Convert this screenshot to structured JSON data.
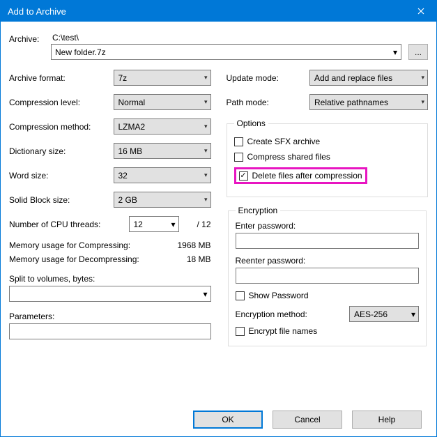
{
  "title": "Add to Archive",
  "archive": {
    "label": "Archive:",
    "path": "C:\\test\\",
    "name": "New folder.7z",
    "browse": "..."
  },
  "left": {
    "format_label": "Archive format:",
    "format_value": "7z",
    "level_label": "Compression level:",
    "level_value": "Normal",
    "method_label": "Compression method:",
    "method_value": "LZMA2",
    "dict_label": "Dictionary size:",
    "dict_value": "16 MB",
    "word_label": "Word size:",
    "word_value": "32",
    "solid_label": "Solid Block size:",
    "solid_value": "2 GB",
    "cpu_label": "Number of CPU threads:",
    "cpu_value": "12",
    "cpu_total": "/ 12",
    "mem_compress_label": "Memory usage for Compressing:",
    "mem_compress_value": "1968 MB",
    "mem_decompress_label": "Memory usage for Decompressing:",
    "mem_decompress_value": "18 MB",
    "split_label": "Split to volumes, bytes:",
    "params_label": "Parameters:"
  },
  "right": {
    "update_label": "Update mode:",
    "update_value": "Add and replace files",
    "pathmode_label": "Path mode:",
    "pathmode_value": "Relative pathnames",
    "options_legend": "Options",
    "opt_sfx": "Create SFX archive",
    "opt_shared": "Compress shared files",
    "opt_delete": "Delete files after compression",
    "encryption_legend": "Encryption",
    "enter_pw": "Enter password:",
    "reenter_pw": "Reenter password:",
    "show_pw": "Show Password",
    "enc_method_label": "Encryption method:",
    "enc_method_value": "AES-256",
    "encrypt_names": "Encrypt file names"
  },
  "buttons": {
    "ok": "OK",
    "cancel": "Cancel",
    "help": "Help"
  }
}
